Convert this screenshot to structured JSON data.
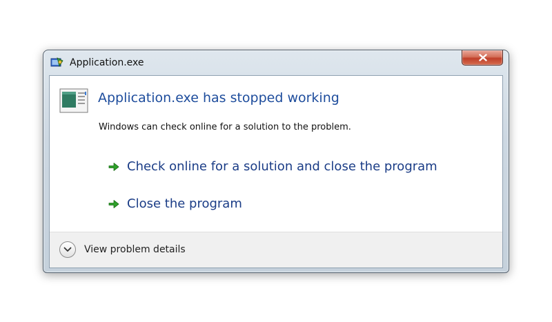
{
  "window": {
    "title": "Application.exe"
  },
  "dialog": {
    "heading": "Application.exe has stopped working",
    "description": "Windows can check online for a solution to the problem.",
    "commands": [
      {
        "label": "Check online for a solution and close the program"
      },
      {
        "label": "Close the program"
      }
    ],
    "details_label": "View problem details"
  },
  "icons": {
    "title": "application-icon",
    "main": "program-window-icon",
    "command": "green-arrow-icon",
    "close": "close-icon",
    "expand": "chevron-down-icon"
  },
  "colors": {
    "heading": "#1d4c9c",
    "command_text": "#1a3c86",
    "close_button": "#c0402a",
    "arrow": "#2fa12a"
  }
}
